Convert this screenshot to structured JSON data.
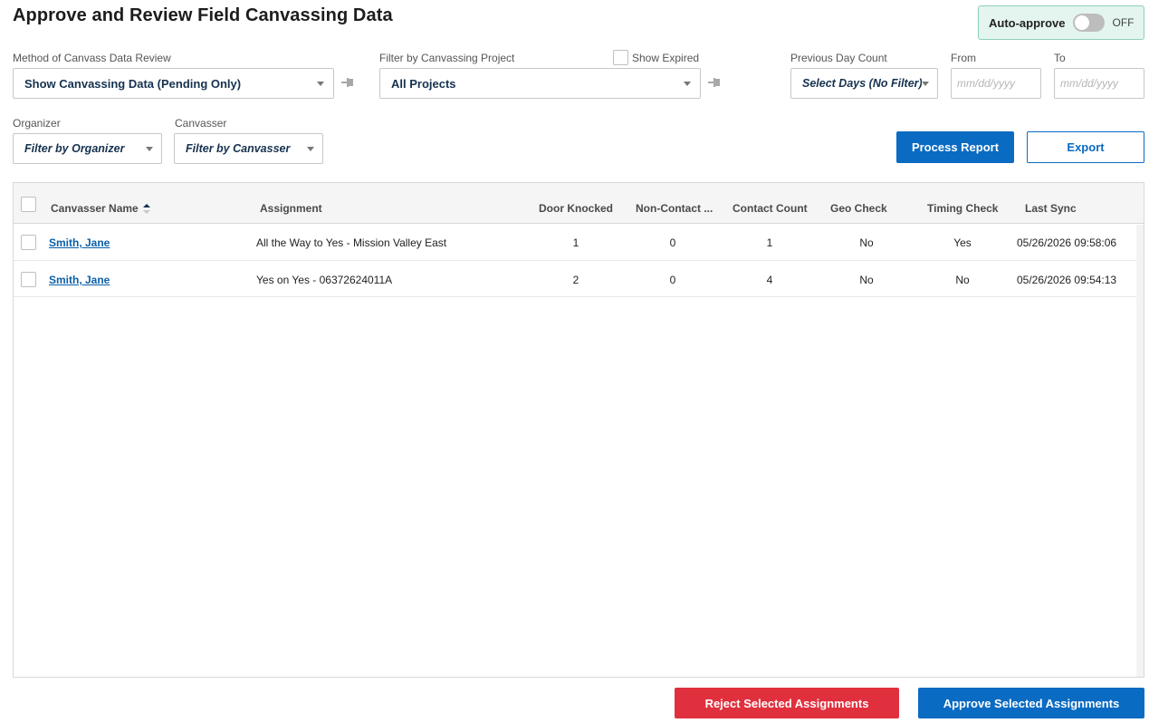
{
  "page": {
    "title": "Approve and Review Field Canvassing Data"
  },
  "auto_approve": {
    "label": "Auto-approve",
    "state": "OFF"
  },
  "filters": {
    "method": {
      "label": "Method of Canvass Data Review",
      "value": "Show Canvassing Data (Pending Only)"
    },
    "project": {
      "label": "Filter by Canvassing Project",
      "value": "All Projects"
    },
    "show_expired": {
      "label": "Show Expired"
    },
    "previous_day": {
      "label": "Previous Day Count",
      "value": "Select Days (No Filter)"
    },
    "from": {
      "label": "From",
      "placeholder": "mm/dd/yyyy"
    },
    "to": {
      "label": "To",
      "placeholder": "mm/dd/yyyy"
    },
    "organizer": {
      "label": "Organizer",
      "value": "Filter by Organizer"
    },
    "canvasser": {
      "label": "Canvasser",
      "value": "Filter by Canvasser"
    }
  },
  "actions": {
    "process_report": "Process Report",
    "export": "Export"
  },
  "table": {
    "columns": {
      "canvasser_name": "Canvasser Name",
      "assignment": "Assignment",
      "door_knocked": "Door Knocked",
      "non_contact": "Non-Contact ...",
      "contact_count": "Contact Count",
      "geo_check": "Geo Check",
      "timing_check": "Timing Check",
      "last_sync": "Last Sync"
    },
    "rows": [
      {
        "name": "Smith, Jane",
        "assignment": "All the Way to Yes - Mission Valley East",
        "door_knocked": "1",
        "non_contact": "0",
        "contact_count": "1",
        "geo_check": "No",
        "timing_check": "Yes",
        "last_sync": "05/26/2026 09:58:06"
      },
      {
        "name": "Smith, Jane",
        "assignment": "Yes on Yes - 06372624011A",
        "door_knocked": "2",
        "non_contact": "0",
        "contact_count": "4",
        "geo_check": "No",
        "timing_check": "No",
        "last_sync": "05/26/2026 09:54:13"
      }
    ]
  },
  "footer": {
    "reject": "Reject Selected Assignments",
    "approve": "Approve Selected Assignments"
  },
  "colors": {
    "primary": "#0a6bc2",
    "reject": "#e0303e",
    "auto_approve_bg": "#e3f5ee",
    "link": "#0a5fa8"
  },
  "icons": {
    "pin": "pin-icon",
    "caret": "chevron-down-icon",
    "sort": "sort-icon"
  }
}
